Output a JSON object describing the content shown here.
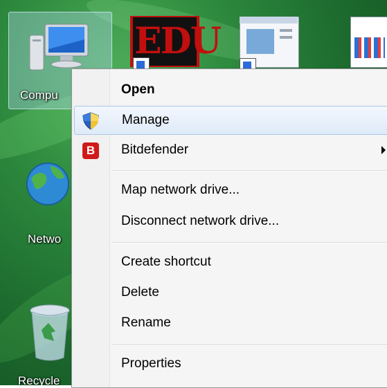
{
  "desktop": {
    "icons": [
      {
        "label": "Compu",
        "icon": "computer-icon"
      },
      {
        "label": "Netwo",
        "icon": "network-globe-icon"
      },
      {
        "label": "Recycle",
        "icon": "recycle-bin-icon"
      },
      {
        "label": "EDU",
        "icon": "edu-shortcut-icon"
      },
      {
        "icon": "window-shortcut-icon"
      },
      {
        "icon": "grid-app-shortcut-icon"
      }
    ]
  },
  "context_menu": {
    "items": [
      {
        "label": "Open",
        "bold": true
      },
      {
        "label": "Manage",
        "icon": "uac-shield-icon",
        "highlighted": true
      },
      {
        "label": "Bitdefender",
        "icon": "bitdefender-icon",
        "icon_text": "B",
        "submenu": true
      },
      {
        "label": "Map network drive..."
      },
      {
        "label": "Disconnect network drive..."
      },
      {
        "label": "Create shortcut"
      },
      {
        "label": "Delete"
      },
      {
        "label": "Rename"
      },
      {
        "label": "Properties"
      }
    ]
  },
  "colors": {
    "desktop": "#2d8a3e",
    "menu_bg": "#f5f5f5",
    "highlight_border": "#a8c8ea",
    "bitdefender_red": "#d01a1a"
  }
}
